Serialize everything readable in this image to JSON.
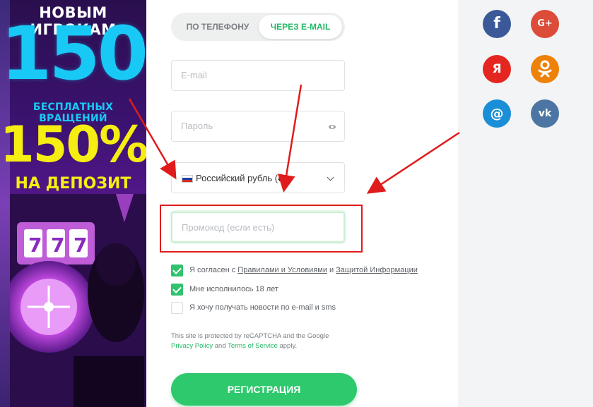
{
  "banner": {
    "line1": "НОВЫМ ИГРОКАМ",
    "spins_number": "150",
    "spins_label": "БЕСПЛАТНЫХ ВРАЩЕНИЙ",
    "deposit_percent": "150%",
    "deposit_label": "НА ДЕПОЗИТ",
    "colors": {
      "cyan": "#19c9f5",
      "yellow": "#f6ee12",
      "purple": "#3b1270"
    }
  },
  "tabs": {
    "phone": "ПО ТЕЛЕФОНУ",
    "email": "ЧЕРЕЗ E-MAIL",
    "active": "email"
  },
  "form": {
    "email_placeholder": "E-mail",
    "password_placeholder": "Пароль",
    "currency_value": "Российский рубль (₽",
    "promo_placeholder": "Промокод (если есть)"
  },
  "checkboxes": {
    "terms": {
      "checked": true,
      "prefix": "Я согласен с",
      "link1": "Правилами и Условиями",
      "and": "и",
      "link2": "Защитой Информации"
    },
    "age": {
      "checked": true,
      "label": "Мне исполнилось 18 лет"
    },
    "news": {
      "checked": false,
      "label": "Я хочу получать новости по e-mail и sms"
    }
  },
  "recaptcha": {
    "text1": "This site is protected by reCAPTCHA and the Google",
    "privacy": "Privacy Policy",
    "and": "and",
    "terms": "Terms of Service",
    "apply": "apply."
  },
  "submit_label": "РЕГИСТРАЦИЯ",
  "social": {
    "facebook": "f",
    "google": "G+",
    "yandex": "Я",
    "odnoklassniki": "ok-icon",
    "mailru": "@",
    "vk": "vk"
  },
  "accent_color": "#2ec86d",
  "annotation_color": "#e01b1b"
}
